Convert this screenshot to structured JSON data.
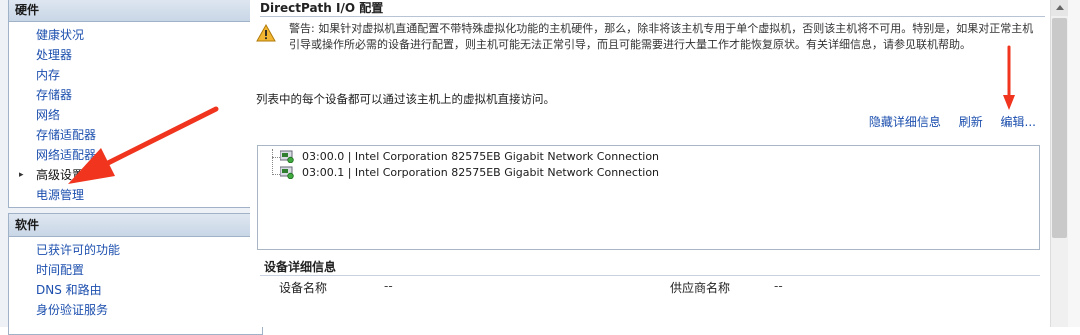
{
  "hardware": {
    "title": "硬件",
    "items": [
      {
        "label": "健康状况"
      },
      {
        "label": "处理器"
      },
      {
        "label": "内存"
      },
      {
        "label": "存储器"
      },
      {
        "label": "网络"
      },
      {
        "label": "存储适配器"
      },
      {
        "label": "网络适配器"
      },
      {
        "label": "高级设置"
      },
      {
        "label": "电源管理"
      }
    ]
  },
  "software": {
    "title": "软件",
    "items": [
      {
        "label": "已获许可的功能"
      },
      {
        "label": "时间配置"
      },
      {
        "label": "DNS 和路由"
      },
      {
        "label": "身份验证服务"
      }
    ]
  },
  "main": {
    "title": "DirectPath I/O 配置",
    "warning": "警告: 如果针对虚拟机直通配置不带特殊虚拟化功能的主机硬件，那么，除非将该主机专用于单个虚拟机，否则该主机将不可用。特别是，如果对正常主机引导或操作所必需的设备进行配置，则主机可能无法正常引导，而且可能需要进行大量工作才能恢复原状。有关详细信息，请参见联机帮助。",
    "description": "列表中的每个设备都可以通过该主机上的虚拟机直接访问。",
    "links": {
      "hide": "隐藏详细信息",
      "refresh": "刷新",
      "edit": "编辑..."
    },
    "devices": [
      {
        "label": "03:00.0 | Intel Corporation 82575EB Gigabit Network Connection"
      },
      {
        "label": "03:00.1 | Intel Corporation 82575EB Gigabit Network Connection"
      }
    ],
    "details": {
      "title": "设备详细信息",
      "device_name_label": "设备名称",
      "device_name_value": "--",
      "vendor_label": "供应商名称",
      "vendor_value": "--"
    }
  },
  "colors": {
    "link": "#1c4fae",
    "annotation_arrow": "#f0341e",
    "warning_icon": "#e8a317"
  }
}
